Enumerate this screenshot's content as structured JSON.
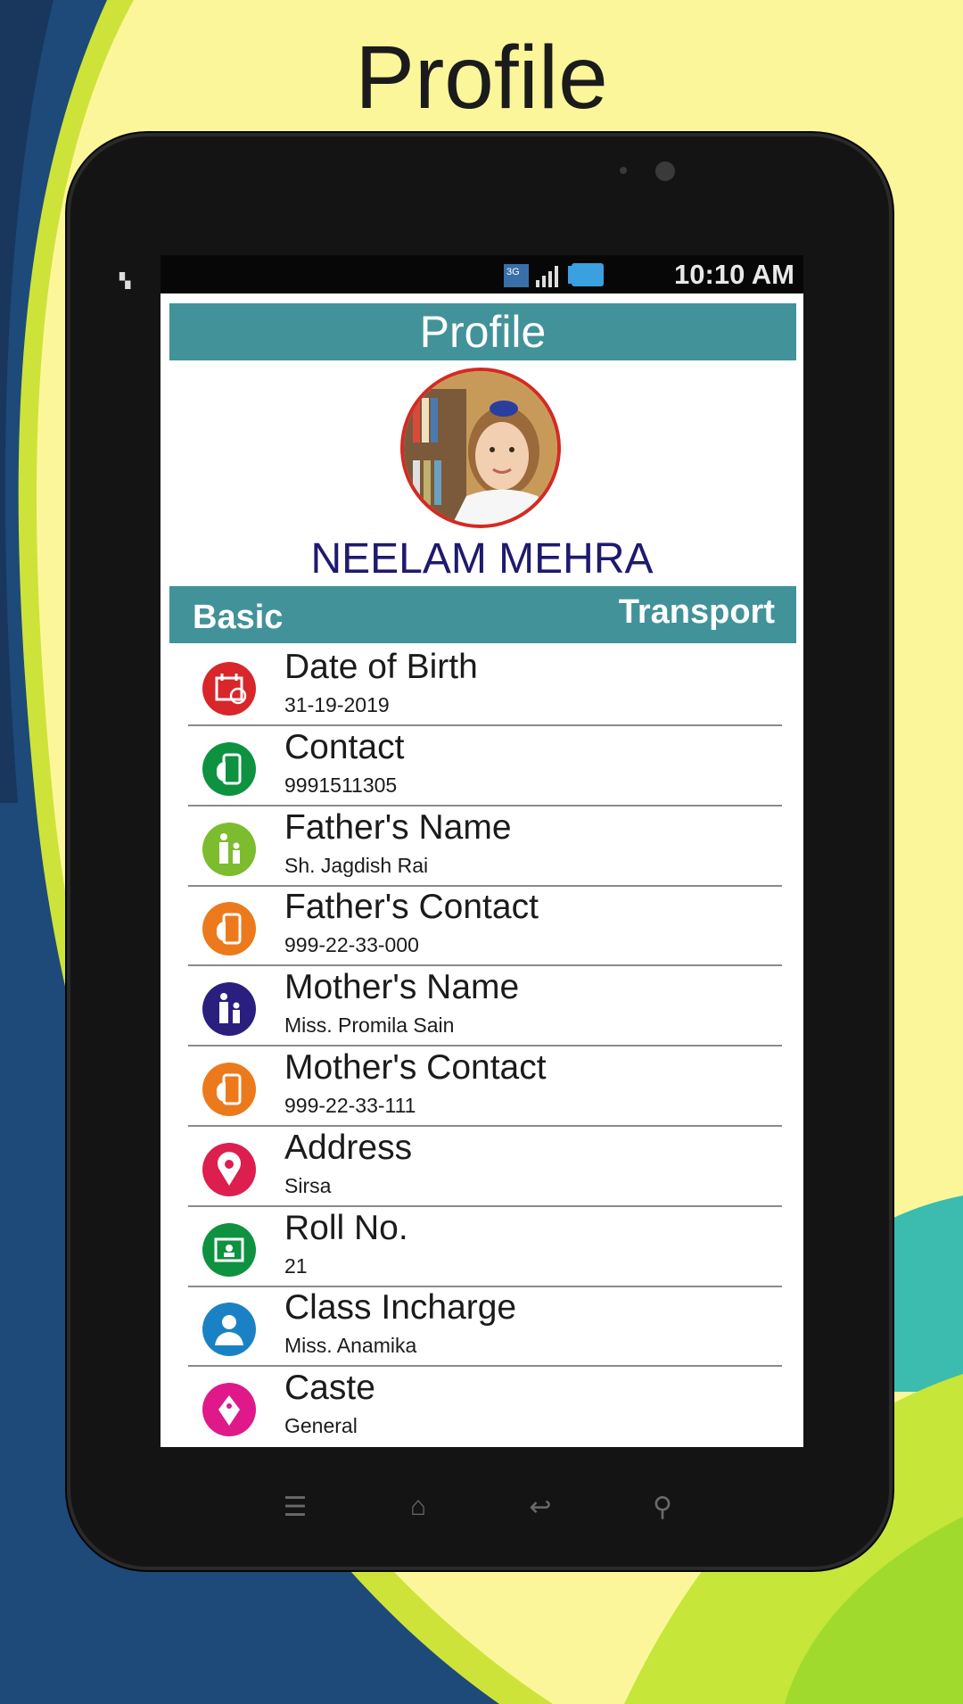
{
  "promo_title": "Profile",
  "status_bar": {
    "time": "10:10 AM",
    "network": "3G"
  },
  "header": {
    "title": "Profile"
  },
  "profile": {
    "name": "NEELAM MEHRA"
  },
  "tabs": [
    {
      "label": "Basic"
    },
    {
      "label": "Transport"
    }
  ],
  "details": [
    {
      "label": "Date of Birth",
      "value": "31-19-2019",
      "icon": "calendar-icon",
      "color": "#d8262a"
    },
    {
      "label": "Contact",
      "value": "9991511305",
      "icon": "phone-hand-icon",
      "color": "#0e9240"
    },
    {
      "label": "Father's Name",
      "value": "Sh. Jagdish Rai",
      "icon": "parent-child-icon",
      "color": "#7cbc2e"
    },
    {
      "label": "Father's Contact",
      "value": "999-22-33-000",
      "icon": "phone-hand-icon",
      "color": "#ec7a1c"
    },
    {
      "label": "Mother's Name",
      "value": "Miss. Promila Sain",
      "icon": "parent-child-icon",
      "color": "#2a1f7e"
    },
    {
      "label": "Mother's Contact",
      "value": "999-22-33-111",
      "icon": "phone-hand-icon",
      "color": "#ec7a1c"
    },
    {
      "label": "Address",
      "value": "Sirsa",
      "icon": "location-pin-icon",
      "color": "#dc1f4e"
    },
    {
      "label": "Roll No.",
      "value": "21",
      "icon": "id-card-icon",
      "color": "#0e9240"
    },
    {
      "label": "Class Incharge",
      "value": "Miss. Anamika",
      "icon": "teacher-icon",
      "color": "#1a82c4"
    },
    {
      "label": "Caste",
      "value": "General",
      "icon": "pen-nib-icon",
      "color": "#e0198a"
    }
  ],
  "colors": {
    "accent": "#42929a",
    "name": "#1e1a6e",
    "avatar_border": "#d42a22"
  }
}
